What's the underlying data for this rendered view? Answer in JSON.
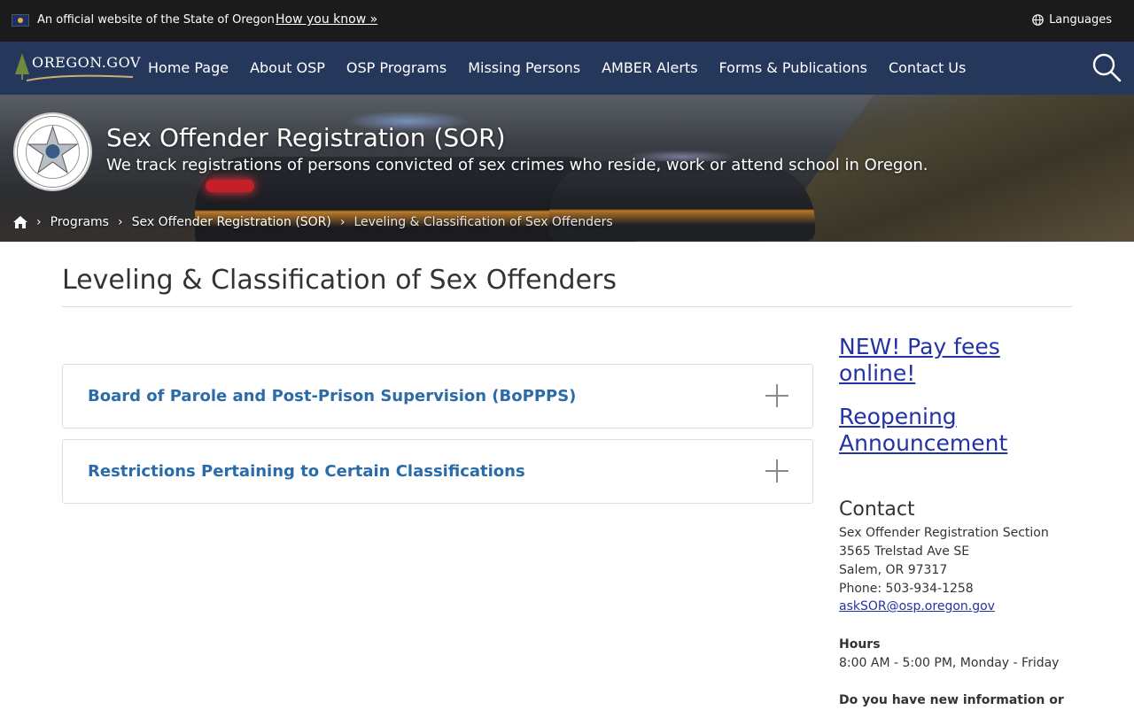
{
  "banner": {
    "official_text": "An official website of the State of Oregon",
    "how_you_know": "How you know »",
    "languages": "Languages"
  },
  "nav": {
    "logo_text": "OREGON.GOV",
    "links": [
      "Home Page",
      "About OSP",
      "OSP Programs",
      "Missing Persons",
      "AMBER Alerts",
      "Forms & Publications",
      "Contact Us"
    ]
  },
  "hero": {
    "title": "Sex Offender Registration (SOR)",
    "subtitle": "We track registrations of persons convicted of sex crimes who reside, work or attend school in Oregon.",
    "breadcrumb": [
      "Programs",
      "Sex Offender Registration (SOR)",
      "Leveling & Classification of Sex Offenders"
    ]
  },
  "main": {
    "page_title": "Leveling & Classification of Sex Offenders",
    "accordions": [
      "Board of Parole and Post-Prison Supervision (BoPPPS)",
      "Restrictions Pertaining to Certain Classifications"
    ]
  },
  "sidebar": {
    "pay_fees": "NEW! Pay fees online!",
    "reopening": "Reopening Announcement",
    "contact_title": "Contact",
    "contact_lines": [
      "Sex Offender Registration Section",
      "3565 Trelstad Ave SE",
      "Salem, OR 97317",
      "Phone: 503-934-1258"
    ],
    "email": "askSOR@osp.oregon.gov",
    "hours_title": "Hours",
    "hours": "8:00 AM - 5:00 PM, Monday - Friday",
    "new_info": "Do you have new information or"
  },
  "colors": {
    "nav_bg": "#25375b",
    "banner_bg": "#1b1b1b",
    "accordion_link": "#2b6ca8",
    "sidebar_link": "#2433a3"
  }
}
